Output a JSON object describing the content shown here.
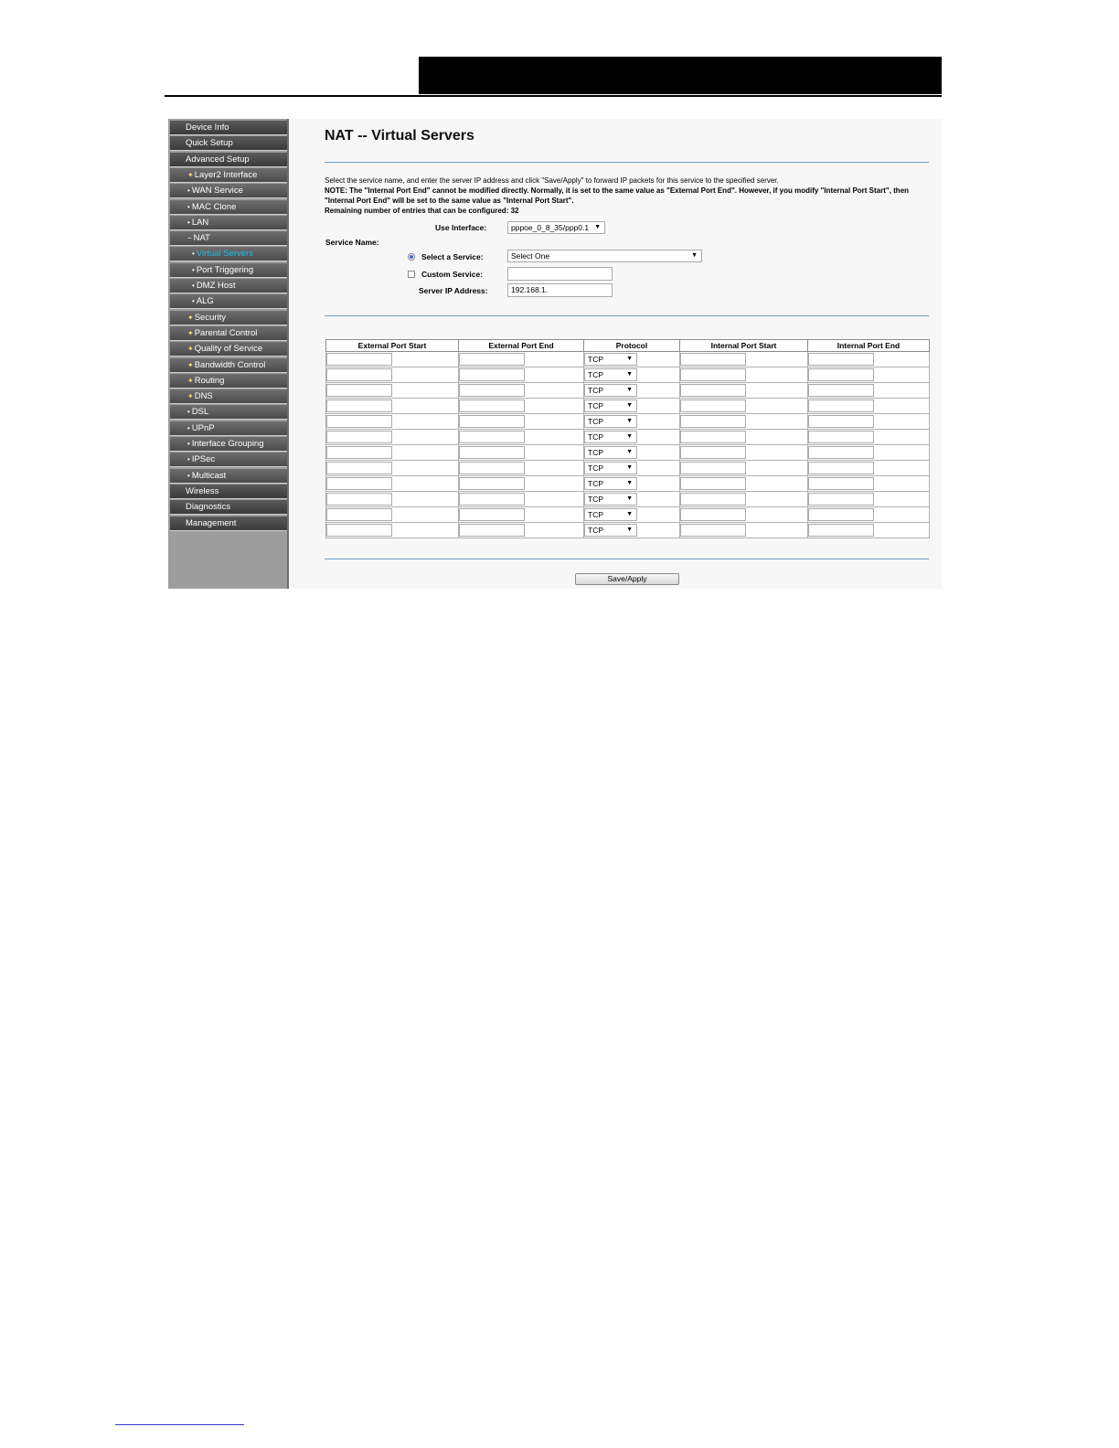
{
  "sidebar": {
    "items": [
      {
        "label": "Device Info",
        "level": 0,
        "bullet": ""
      },
      {
        "label": "Quick Setup",
        "level": 0,
        "bullet": ""
      },
      {
        "label": "Advanced Setup",
        "level": 0,
        "bullet": ""
      },
      {
        "label": "Layer2 Interface",
        "level": 1,
        "bullet": "✦"
      },
      {
        "label": "WAN Service",
        "level": 1,
        "bullet": "•"
      },
      {
        "label": "MAC Clone",
        "level": 1,
        "bullet": "•"
      },
      {
        "label": "LAN",
        "level": 1,
        "bullet": "•"
      },
      {
        "label": "NAT",
        "level": 1,
        "bullet": "−"
      },
      {
        "label": "Virtual Servers",
        "level": 2,
        "bullet": "•",
        "active": true
      },
      {
        "label": "Port Triggering",
        "level": 2,
        "bullet": "•"
      },
      {
        "label": "DMZ Host",
        "level": 2,
        "bullet": "•"
      },
      {
        "label": "ALG",
        "level": 2,
        "bullet": "•"
      },
      {
        "label": "Security",
        "level": 1,
        "bullet": "✦"
      },
      {
        "label": "Parental Control",
        "level": 1,
        "bullet": "✦"
      },
      {
        "label": "Quality of Service",
        "level": 1,
        "bullet": "✦"
      },
      {
        "label": "Bandwidth Control",
        "level": 1,
        "bullet": "✦"
      },
      {
        "label": "Routing",
        "level": 1,
        "bullet": "✦"
      },
      {
        "label": "DNS",
        "level": 1,
        "bullet": "✦"
      },
      {
        "label": "DSL",
        "level": 1,
        "bullet": "•"
      },
      {
        "label": "UPnP",
        "level": 1,
        "bullet": "•"
      },
      {
        "label": "Interface Grouping",
        "level": 1,
        "bullet": "•"
      },
      {
        "label": "IPSec",
        "level": 1,
        "bullet": "•"
      },
      {
        "label": "Multicast",
        "level": 1,
        "bullet": "•"
      },
      {
        "label": "Wireless",
        "level": 0,
        "bullet": ""
      },
      {
        "label": "Diagnostics",
        "level": 0,
        "bullet": ""
      },
      {
        "label": "Management",
        "level": 0,
        "bullet": ""
      }
    ]
  },
  "page": {
    "title": "NAT -- Virtual Servers",
    "description": "Select the service name, and enter the server IP address and click \"Save/Apply\" to forward IP packets for this service to the specified server.",
    "note": "NOTE: The \"Internal Port End\" cannot be modified directly. Normally, it is set to the same value as \"External Port End\". However, if you modify \"Internal Port Start\", then \"Internal Port End\" will be set to the same value as \"Internal Port Start\".",
    "remaining": "Remaining number of entries that can be configured: 32"
  },
  "form": {
    "use_interface_label": "Use Interface:",
    "use_interface_value": "pppoe_0_8_35/ppp0.1",
    "service_name_label": "Service Name:",
    "select_service_label": "Select a Service:",
    "select_service_value": "Select One",
    "custom_service_label": "Custom Service:",
    "custom_service_value": "",
    "server_ip_label": "Server IP Address:",
    "server_ip_value": "192.168.1."
  },
  "table": {
    "headers": [
      "External Port Start",
      "External Port End",
      "Protocol",
      "Internal Port Start",
      "Internal Port End"
    ],
    "rows": [
      {
        "protocol": "TCP"
      },
      {
        "protocol": "TCP"
      },
      {
        "protocol": "TCP"
      },
      {
        "protocol": "TCP"
      },
      {
        "protocol": "TCP"
      },
      {
        "protocol": "TCP"
      },
      {
        "protocol": "TCP"
      },
      {
        "protocol": "TCP"
      },
      {
        "protocol": "TCP"
      },
      {
        "protocol": "TCP"
      },
      {
        "protocol": "TCP"
      },
      {
        "protocol": "TCP"
      }
    ]
  },
  "actions": {
    "save_label": "Save/Apply"
  },
  "colors": {
    "sidebar_active": "#1fb8e8",
    "rule": "#6a9ec2"
  }
}
